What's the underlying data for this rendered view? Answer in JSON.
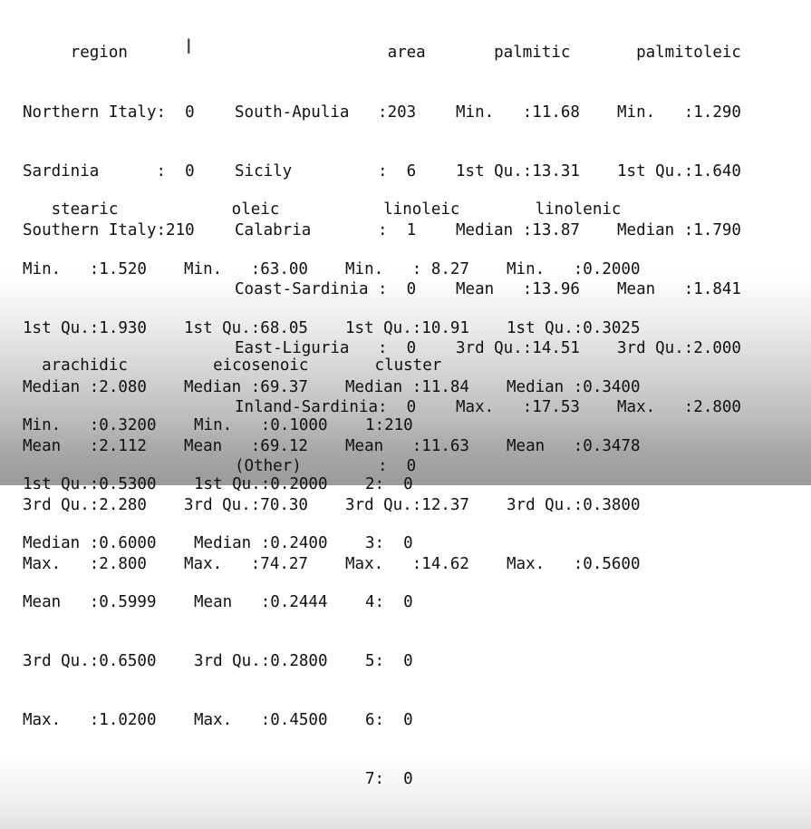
{
  "summary": {
    "row1": [
      {
        "name": "region",
        "lines": [
          "     region",
          "Northern Italy:  0",
          "Sardinia      :  0",
          "Southern Italy:210"
        ]
      },
      {
        "name": "area",
        "lines": [
          "                area",
          "South-Apulia   :203",
          "Sicily         :  6",
          "Calabria       :  1",
          "Coast-Sardinia :  0",
          "East-Liguria   :  0",
          "Inland-Sardinia:  0",
          "(Other)        :  0"
        ]
      },
      {
        "name": "palmitic",
        "lines": [
          "    palmitic",
          "Min.   :11.68",
          "1st Qu.:13.31",
          "Median :13.87",
          "Mean   :13.96",
          "3rd Qu.:14.51",
          "Max.   :17.53"
        ]
      },
      {
        "name": "palmitoleic",
        "lines": [
          "  palmitoleic",
          "Min.   :1.290",
          "1st Qu.:1.640",
          "Median :1.790",
          "Mean   :1.841",
          "3rd Qu.:2.000",
          "Max.   :2.800"
        ]
      }
    ],
    "row2": [
      {
        "name": "stearic",
        "lines": [
          "   stearic",
          "Min.   :1.520",
          "1st Qu.:1.930",
          "Median :2.080",
          "Mean   :2.112",
          "3rd Qu.:2.280",
          "Max.   :2.800"
        ]
      },
      {
        "name": "oleic",
        "lines": [
          "     oleic",
          "Min.   :63.00",
          "1st Qu.:68.05",
          "Median :69.37",
          "Mean   :69.12",
          "3rd Qu.:70.30",
          "Max.   :74.27"
        ]
      },
      {
        "name": "linoleic",
        "lines": [
          "    linoleic",
          "Min.   : 8.27",
          "1st Qu.:10.91",
          "Median :11.84",
          "Mean   :11.63",
          "3rd Qu.:12.37",
          "Max.   :14.62"
        ]
      },
      {
        "name": "linolenic",
        "lines": [
          "   linolenic",
          "Min.   :0.2000",
          "1st Qu.:0.3025",
          "Median :0.3400",
          "Mean   :0.3478",
          "3rd Qu.:0.3800",
          "Max.   :0.5600"
        ]
      }
    ],
    "row3": [
      {
        "name": "arachidic",
        "lines": [
          "  arachidic",
          "Min.   :0.3200",
          "1st Qu.:0.5300",
          "Median :0.6000",
          "Mean   :0.5999",
          "3rd Qu.:0.6500",
          "Max.   :1.0200"
        ]
      },
      {
        "name": "eicosenoic",
        "lines": [
          "  eicosenoic",
          "Min.   :0.1000",
          "1st Qu.:0.2000",
          "Median :0.2400",
          "Mean   :0.2444",
          "3rd Qu.:0.2800",
          "Max.   :0.4500"
        ]
      },
      {
        "name": "cluster",
        "lines": [
          " cluster",
          "1:210",
          "2:  0",
          "3:  0",
          "4:  0",
          "5:  0",
          "6:  0",
          "7:  0"
        ]
      }
    ]
  },
  "cursor_icon": "text-cursor-icon"
}
